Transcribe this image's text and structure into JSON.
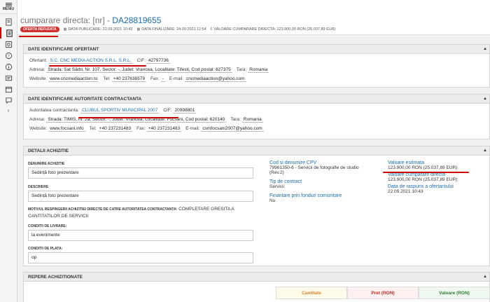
{
  "sidebar": {
    "menu_label": "MENIU"
  },
  "header": {
    "title_prefix": "cumparare directa: [nr] - ",
    "title_id": "DA28819655",
    "status_badge": "OFERTA REFUZATA",
    "publish_date": "DATA PUBLICARE: 22.09.2021 10:42",
    "final_date": "DATA FINALIZARE: 24.09.2021 11:54",
    "value_text": "VALOARE CUMPARARE DIRECTA: 123.900,00 RON (25.037,89 EUR)"
  },
  "ofertant": {
    "title": "DATE IDENTIFICARE OFERTANT",
    "ofertant_label": "Ofertant:",
    "ofertant_value": "S.C. CNC MEDIA ACTION S.R.L. S.R.L.",
    "cif_label": "CIF:",
    "cif_value": "42797736",
    "adresa_label": "Adresa:",
    "adresa_value": "Strada: Sat Sârbi, Nr. 107, Sector: -, Judet: Vrancea, Localitate: Tifesti, Cod postal: 627375",
    "tara_label": "Tara:",
    "tara_value": "Romania",
    "website_label": "Website:",
    "website_value": "www.cncmediaaction.ro",
    "tel_label": "Tel:",
    "tel_value": "+40 237636579",
    "fax_label": "Fax:",
    "fax_value": "-",
    "email_label": "E-mail:",
    "email_value": "cncmediaaction@yahoo.com"
  },
  "autoritate": {
    "title": "DATE IDENTIFICARE AUTORITATE CONTRACTANTA",
    "aut_label": "Autoritatea contractanta:",
    "aut_value": "CLUBUL SPORTIV MUNICIPAL 2007",
    "cif_label": "CIF:",
    "cif_value": "20998801",
    "adresa_label": "Adresa:",
    "adresa_value": "Strada: TIMIS, nr. 2a, Sector: -, Judet: Vrancea, Localitate: Focsani, Cod postal: 620140",
    "tara_label": "Tara:",
    "tara_value": "Romania",
    "website_label": "Website:",
    "website_value": "www.focsani.info",
    "tel_label": "Tel:",
    "tel_value": "+40 237231483",
    "fax_label": "Fax:",
    "fax_value": "+40 237231483",
    "email_label": "E-mail:",
    "email_value": "csmfocsani2007@yahoo.com"
  },
  "detalii": {
    "title": "DETALII ACHIZITIE",
    "denumire_label": "DENUMIRE ACHIZITIE",
    "denumire_value": "Sedință foto prezentare",
    "descriere_label": "DESCRIERE",
    "descriere_value": "Sedință foto prezentare",
    "motiv_label": "MOTIVUL RESPINGERII ACHIZITIEI DIRECTE DE CATRE AUTORITATEA CONTRACTANTA:",
    "motiv_value": "COMPLETARE GRESITA A CANTITATILOR DE SERVICII",
    "livrare_label": "CONDITII DE LIVRARE:",
    "livrare_value": "la evenimente",
    "plata_label": "CONDITII DE PLATA:",
    "plata_value": "op",
    "cpv_title": "Cod si denumire CPV",
    "cpv_value": "79961350-6 - Servicii de fotografie de studio (Rev.2)",
    "tip_title": "Tip de contract",
    "tip_value": "Servicii",
    "finantare_title": "Finantare prin fonduri comunitare",
    "finantare_value": "Nu",
    "val_est_title": "Valoare estimata",
    "val_est_value": "123.900,00  RON (25.037,89  EUR)",
    "val_cump_title": "Valoare cumparare directa",
    "val_cump_value": "123.900,00  RON (25.037,89  EUR)",
    "data_rasp_title": "Data de raspuns a ofertantului",
    "data_rasp_value": "22.09.2021 10:43"
  },
  "repere": {
    "title": "REPERE ACHIZITIONATE",
    "col_cantitate": "Cantitate",
    "col_pret": "Pret (RON)",
    "col_valoare": "Valoare (RON)"
  }
}
